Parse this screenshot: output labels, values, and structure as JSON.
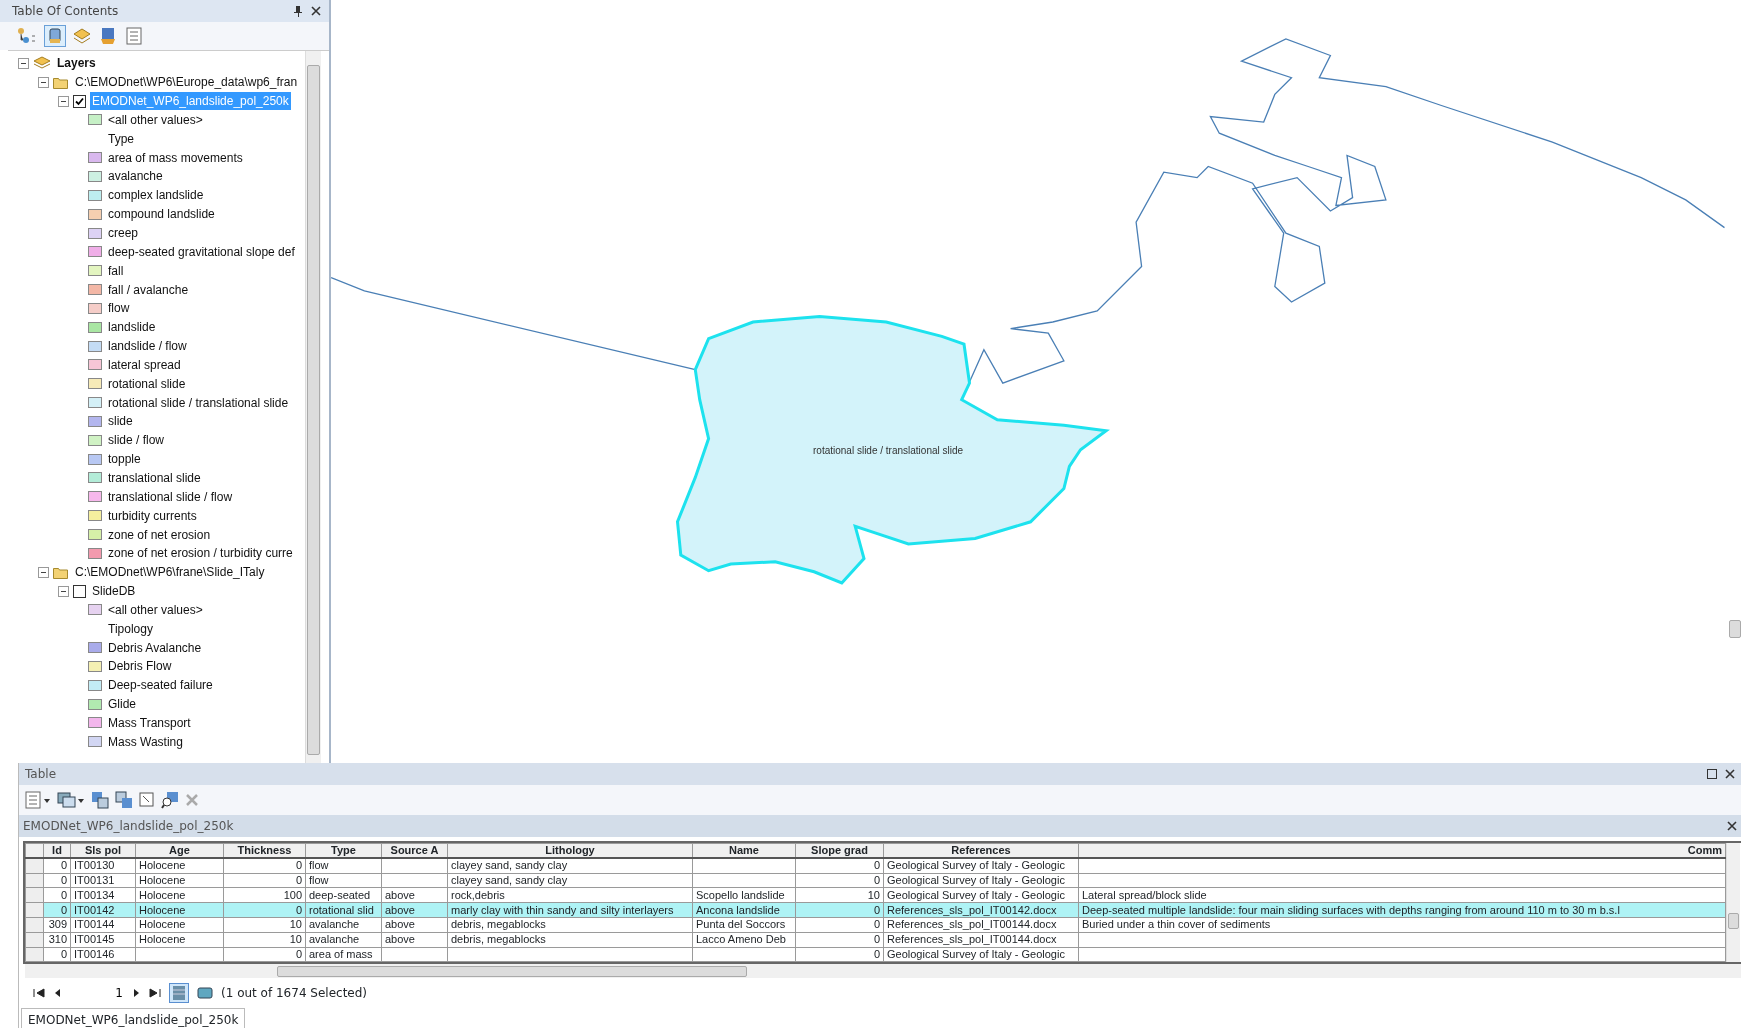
{
  "toc": {
    "title": "Table Of Contents",
    "tree": [
      {
        "kind": "root",
        "label": "Layers",
        "expanded": true,
        "children": [
          {
            "kind": "folder",
            "label": "C:\\EMODnet\\WP6\\Europe_data\\wp6_fran",
            "expanded": true,
            "children": [
              {
                "kind": "layer",
                "label": "EMODNet_WP6_landslide_pol_250k",
                "checked": true,
                "selected": true,
                "expanded": true,
                "children": [
                  {
                    "kind": "swatch",
                    "label": "<all other values>",
                    "color": "#c6f0c6"
                  },
                  {
                    "kind": "heading",
                    "label": "Type"
                  },
                  {
                    "kind": "swatch",
                    "label": "area of mass movements",
                    "color": "#d9b8ee"
                  },
                  {
                    "kind": "swatch",
                    "label": "avalanche",
                    "color": "#cdf0e2"
                  },
                  {
                    "kind": "swatch",
                    "label": "complex landslide",
                    "color": "#bdeef0"
                  },
                  {
                    "kind": "swatch",
                    "label": "compound landslide",
                    "color": "#f5cfb0"
                  },
                  {
                    "kind": "swatch",
                    "label": "creep",
                    "color": "#ddd2f5"
                  },
                  {
                    "kind": "swatch",
                    "label": "deep-seated gravitational slope def",
                    "color": "#f0aee8"
                  },
                  {
                    "kind": "swatch",
                    "label": "fall",
                    "color": "#e3f5c0"
                  },
                  {
                    "kind": "swatch",
                    "label": "fall / avalanche",
                    "color": "#f3b7a6"
                  },
                  {
                    "kind": "swatch",
                    "label": "flow",
                    "color": "#f5cdc8"
                  },
                  {
                    "kind": "swatch",
                    "label": "landslide",
                    "color": "#a9e6a3"
                  },
                  {
                    "kind": "swatch",
                    "label": "landslide / flow",
                    "color": "#c4dcf5"
                  },
                  {
                    "kind": "swatch",
                    "label": "lateral spread",
                    "color": "#f7c6d6"
                  },
                  {
                    "kind": "swatch",
                    "label": "rotational slide",
                    "color": "#f7ebb8"
                  },
                  {
                    "kind": "swatch",
                    "label": "rotational slide / translational slide",
                    "color": "#d4f0f7"
                  },
                  {
                    "kind": "swatch",
                    "label": "slide",
                    "color": "#b3b6ee"
                  },
                  {
                    "kind": "swatch",
                    "label": "slide / flow",
                    "color": "#d0f2c4"
                  },
                  {
                    "kind": "swatch",
                    "label": "topple",
                    "color": "#b8c8f3"
                  },
                  {
                    "kind": "swatch",
                    "label": "translational slide",
                    "color": "#b3ecd8"
                  },
                  {
                    "kind": "swatch",
                    "label": "translational slide / flow",
                    "color": "#f7b8ec"
                  },
                  {
                    "kind": "swatch",
                    "label": "turbidity currents",
                    "color": "#f5ef9e"
                  },
                  {
                    "kind": "swatch",
                    "label": "zone of net erosion",
                    "color": "#d6f0a8"
                  },
                  {
                    "kind": "swatch",
                    "label": "zone of net erosion / turbidity curre",
                    "color": "#f39aae"
                  }
                ]
              }
            ]
          },
          {
            "kind": "folder",
            "label": "C:\\EMODnet\\WP6\\frane\\Slide_ITaly",
            "expanded": true,
            "children": [
              {
                "kind": "layer",
                "label": "SlideDB",
                "checked": false,
                "selected": false,
                "expanded": true,
                "children": [
                  {
                    "kind": "swatch",
                    "label": "<all other values>",
                    "color": "#e6d2f0"
                  },
                  {
                    "kind": "heading",
                    "label": "Tipology"
                  },
                  {
                    "kind": "swatch",
                    "label": "Debris Avalanche",
                    "color": "#a9abea"
                  },
                  {
                    "kind": "swatch",
                    "label": "Debris Flow",
                    "color": "#f5f0b3"
                  },
                  {
                    "kind": "swatch",
                    "label": "Deep-seated failure",
                    "color": "#c3ecf5"
                  },
                  {
                    "kind": "swatch",
                    "label": "Glide",
                    "color": "#b1eab0"
                  },
                  {
                    "kind": "swatch",
                    "label": "Mass Transport",
                    "color": "#f3b6ec"
                  },
                  {
                    "kind": "swatch",
                    "label": "Mass Wasting",
                    "color": "#d2d6f3"
                  }
                ]
              }
            ]
          }
        ]
      }
    ]
  },
  "map": {
    "feature_label": "rotational slide / translational slide"
  },
  "table": {
    "title": "Table",
    "layer_name": "EMODNet_WP6_landslide_pol_250k",
    "columns": [
      "Id",
      "Sls pol",
      "Age",
      "Thickness",
      "Type",
      "Source A",
      "Lithology",
      "Name",
      "Slope grad",
      "References",
      "Comm"
    ],
    "rows": [
      {
        "selected": false,
        "cells": [
          "0",
          "IT00130",
          "Holocene",
          "0",
          "flow",
          "",
          "clayey sand, sandy clay",
          "",
          "0",
          "Geological Survey of Italy - Geologic",
          ""
        ]
      },
      {
        "selected": false,
        "cells": [
          "0",
          "IT00131",
          "Holocene",
          "0",
          "flow",
          "",
          "clayey sand, sandy clay",
          "",
          "0",
          "Geological Survey of Italy - Geologic",
          ""
        ]
      },
      {
        "selected": false,
        "cells": [
          "0",
          "IT00134",
          "Holocene",
          "100",
          "deep-seated",
          "above",
          "rock,debris",
          "Scopello landslide",
          "10",
          "Geological Survey of Italy - Geologic",
          "Lateral spread/block slide"
        ]
      },
      {
        "selected": true,
        "cells": [
          "0",
          "IT00142",
          "Holocene",
          "0",
          "rotational slid",
          "above",
          "marly clay with thin sandy and silty interlayers",
          "Ancona landslide",
          "0",
          "References_sls_pol_IT00142.docx",
          "Deep-seated multiple landslide: four main sliding surfaces with depths ranging from around 110 m to 30 m b.s.l"
        ]
      },
      {
        "selected": false,
        "cells": [
          "309",
          "IT00144",
          "Holocene",
          "10",
          "avalanche",
          "above",
          "debris, megablocks",
          "Punta del Soccors",
          "0",
          "References_sls_pol_IT00144.docx",
          "Buried under a thin cover of sediments"
        ]
      },
      {
        "selected": false,
        "cells": [
          "310",
          "IT00145",
          "Holocene",
          "10",
          "avalanche",
          "above",
          "debris, megablocks",
          "Lacco Ameno Deb",
          "0",
          "References_sls_pol_IT00144.docx",
          ""
        ]
      },
      {
        "selected": false,
        "cells": [
          "0",
          "IT00146",
          "",
          "0",
          "area of mass",
          "",
          "",
          "",
          "0",
          "Geological Survey of Italy - Geologic",
          ""
        ]
      }
    ],
    "page": "1",
    "status": "(1 out of 1674 Selected)",
    "tab": "EMODNet_WP6_landslide_pol_250k"
  }
}
